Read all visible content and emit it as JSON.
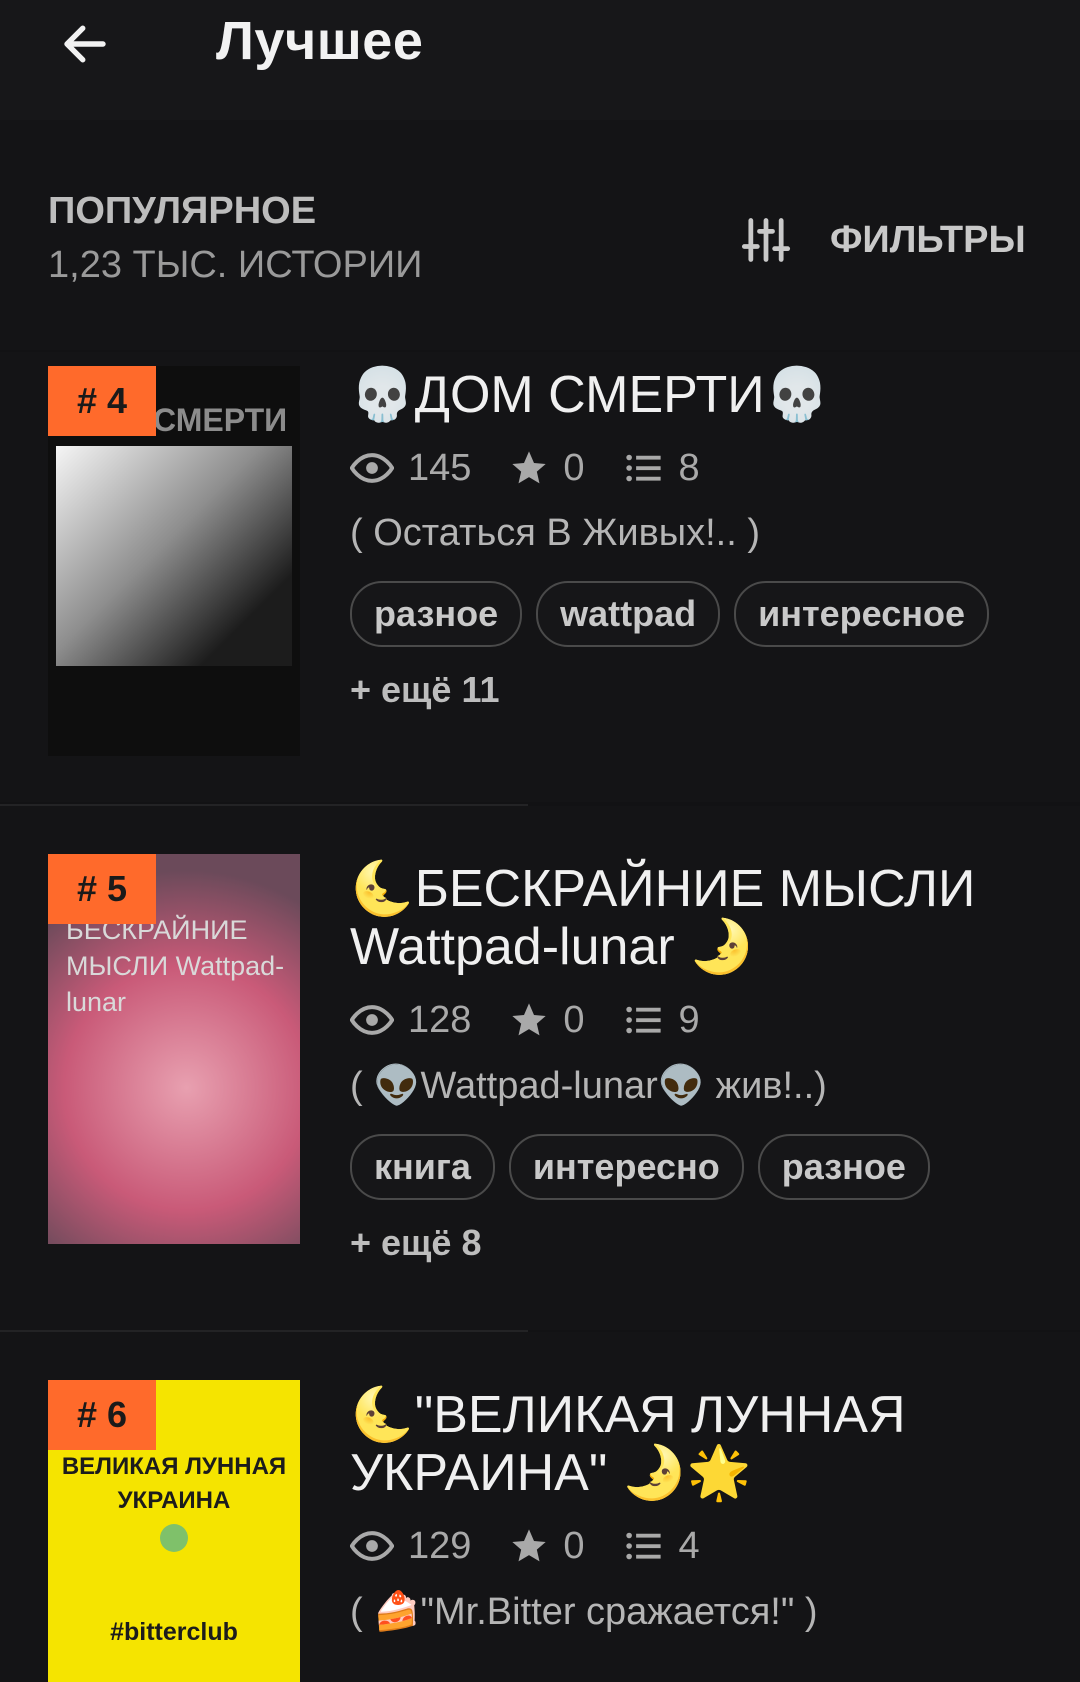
{
  "header": {
    "title": "Лучшее"
  },
  "section": {
    "title": "ПОПУЛЯРНОЕ",
    "count": "1,23 ТЫС. ИСТОРИИ",
    "filters_label": "ФИЛЬТРЫ"
  },
  "stories": [
    {
      "rank": "# 4",
      "cover_text": "СМЕРТИ",
      "title": "💀ДОМ СМЕРТИ💀",
      "views": "145",
      "votes": "0",
      "parts": "8",
      "tagline": "(   Остаться В Живых!.. )",
      "tags": [
        "разное",
        "wattpad",
        "интересное"
      ],
      "more": "+ ещё 11"
    },
    {
      "rank": "# 5",
      "cover_text": "БЕСКРАЙНИЕ МЫСЛИ Wattpad-lunar",
      "title": "🌜БЕСКРАЙНИЕ МЫСЛИ Wattpad-lunar 🌛",
      "views": "128",
      "votes": "0",
      "parts": "9",
      "tagline": "( 👽Wattpad-lunar👽 жив!..)",
      "tags": [
        "книга",
        "интересно",
        "разное"
      ],
      "more": "+ ещё 8"
    },
    {
      "rank": "# 6",
      "cover_text_top": "ВЕЛИКАЯ ЛУННАЯ УКРАИНА",
      "cover_text_bottom": "#bitterclub",
      "title": "🌜\"ВЕЛИКАЯ ЛУННАЯ УКРАИНА\" 🌛🌟",
      "views": "129",
      "votes": "0",
      "parts": "4",
      "tagline": "( 🍰\"Mr.Bitter сражается!\" )"
    }
  ],
  "colors": {
    "rank_badge": "#ff6a2b",
    "background": "#121214"
  },
  "icons": [
    "back-arrow-icon",
    "filter-sliders-icon",
    "eye-icon",
    "star-icon",
    "list-icon"
  ]
}
